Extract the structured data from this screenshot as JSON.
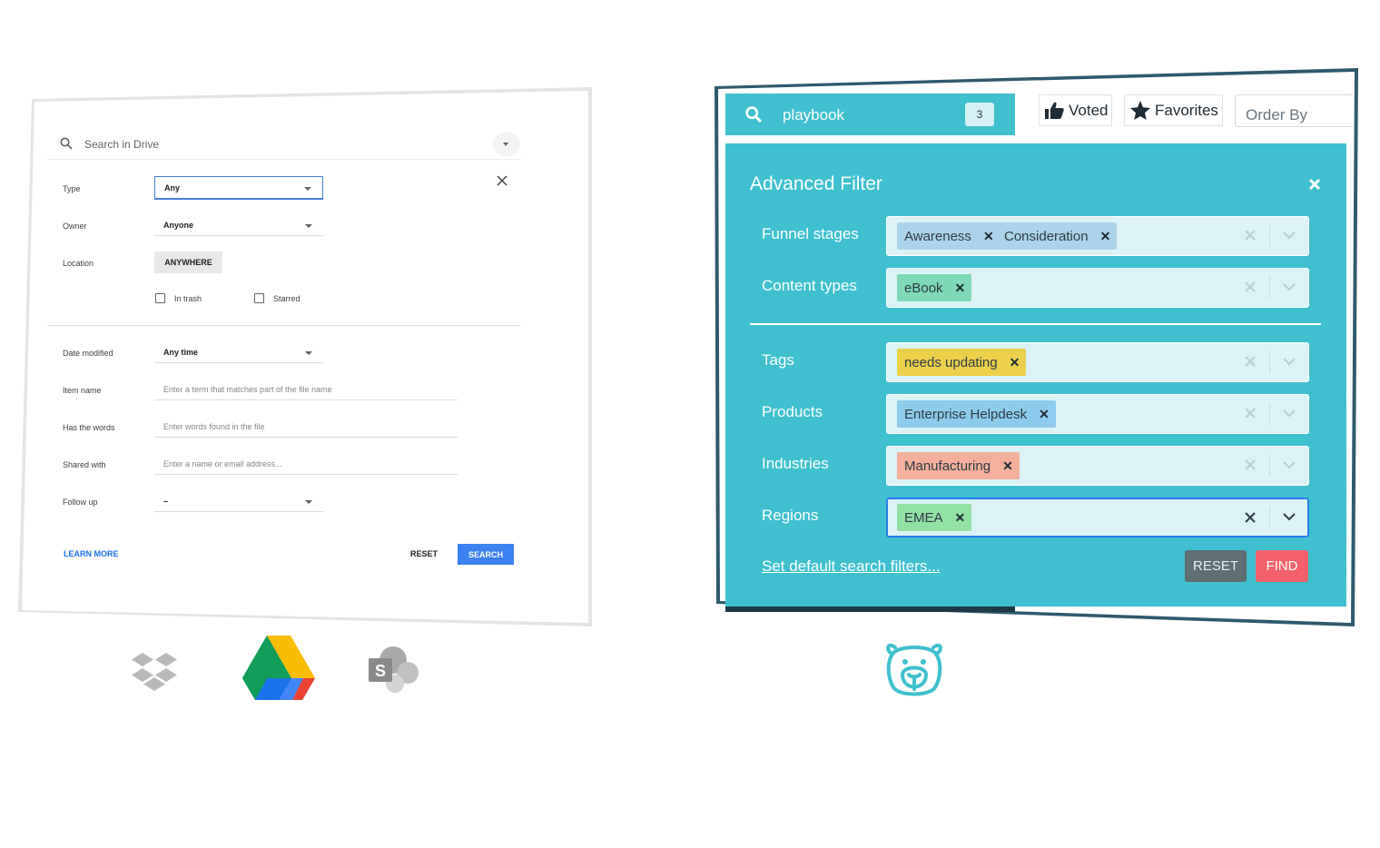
{
  "drive": {
    "search_placeholder": "Search in Drive",
    "fields": {
      "type_label": "Type",
      "type_value": "Any",
      "owner_label": "Owner",
      "owner_value": "Anyone",
      "location_label": "Location",
      "location_button": "ANYWHERE",
      "in_trash_label": "In trash",
      "starred_label": "Starred",
      "date_modified_label": "Date modified",
      "date_modified_value": "Any time",
      "item_name_label": "Item name",
      "item_name_placeholder": "Enter a term that matches part of the file name",
      "has_words_label": "Has the words",
      "has_words_placeholder": "Enter words found in the file",
      "shared_with_label": "Shared with",
      "shared_with_placeholder": "Enter a name or email address...",
      "follow_up_label": "Follow up",
      "follow_up_value": "–"
    },
    "learn_more": "LEARN MORE",
    "reset": "RESET",
    "search": "SEARCH"
  },
  "logos": [
    "dropbox-logo",
    "google-drive-logo",
    "sharepoint-logo",
    "bear-logo"
  ],
  "filter": {
    "query": "playbook",
    "result_count": "3",
    "voted": "Voted",
    "favorites": "Favorites",
    "order_by_placeholder": "Order By",
    "title": "Advanced Filter",
    "rows": {
      "funnel_label": "Funnel stages",
      "funnel_chips": [
        "Awareness",
        "Consideration"
      ],
      "content_label": "Content types",
      "content_chips": [
        "eBook"
      ],
      "tags_label": "Tags",
      "tags_chips": [
        "needs updating"
      ],
      "products_label": "Products",
      "products_chips": [
        "Enterprise Helpdesk"
      ],
      "industries_label": "Industries",
      "industries_chips": [
        "Manufacturing"
      ],
      "regions_label": "Regions",
      "regions_chips": [
        "EMEA"
      ]
    },
    "default_link": "Set default search filters...",
    "reset": "RESET",
    "find": "FIND"
  },
  "colors": {
    "panel": "#3fc0cf",
    "chip_funnel": "#a9d4ea",
    "chip_content": "#7fd9b6",
    "chip_tags": "#ecd04b",
    "chip_products": "#8ecaec",
    "chip_industries": "#f4b09a",
    "chip_regions": "#93e0a3",
    "find": "#f3626b",
    "reset": "#5e6e73"
  }
}
